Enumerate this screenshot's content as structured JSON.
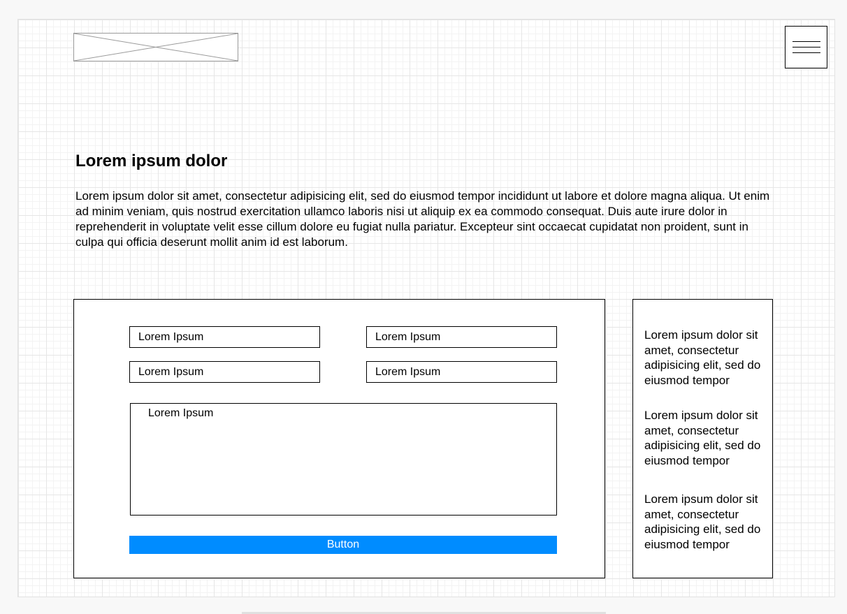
{
  "header": {
    "logo_icon": "image-placeholder-icon",
    "menu_icon": "hamburger-menu-icon"
  },
  "intro": {
    "heading": "Lorem ipsum dolor",
    "paragraph": "Lorem ipsum dolor sit amet, consectetur adipisicing elit, sed do eiusmod tempor incididunt ut labore et dolore magna aliqua. Ut enim ad minim veniam, quis nostrud exercitation ullamco laboris nisi ut aliquip ex ea commodo consequat. Duis aute irure dolor in reprehenderit in voluptate velit esse cillum dolore eu fugiat nulla pariatur. Excepteur sint occaecat cupidatat non proident, sunt in culpa qui officia deserunt mollit anim id est laborum."
  },
  "form": {
    "field_1_placeholder": "Lorem Ipsum",
    "field_2_placeholder": "Lorem Ipsum",
    "field_3_placeholder": "Lorem Ipsum",
    "field_4_placeholder": "Lorem Ipsum",
    "textarea_placeholder": "Lorem Ipsum",
    "button_label": "Button",
    "button_color": "#008cff"
  },
  "sidebar": {
    "blocks": [
      "Lorem ipsum dolor sit amet, consectetur adipisicing elit, sed do eiusmod tempor",
      "Lorem ipsum dolor sit amet, consectetur adipisicing elit, sed do eiusmod tempor",
      "Lorem ipsum dolor sit amet, consectetur adipisicing elit, sed do eiusmod tempor"
    ]
  }
}
